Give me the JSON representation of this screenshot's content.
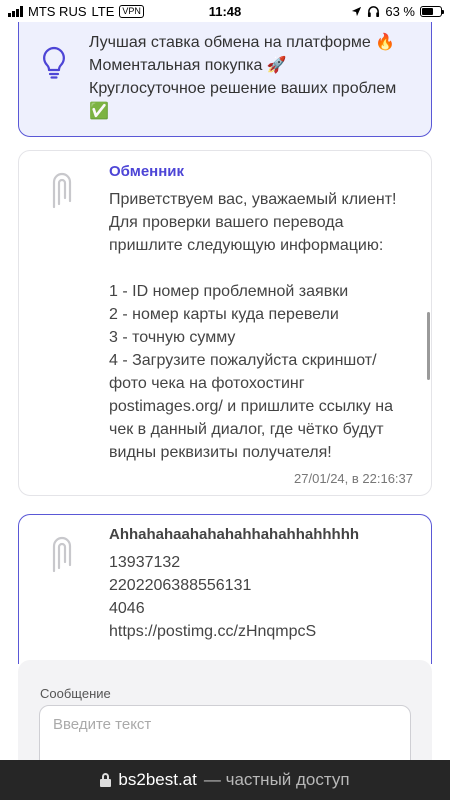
{
  "status_bar": {
    "carrier": "MTS RUS",
    "network": "LTE",
    "vpn": "VPN",
    "time": "11:48",
    "battery": "63 %",
    "battery_level": 0.63,
    "icons": [
      "signal-icon",
      "location-arrow-icon",
      "headphones-icon",
      "battery-icon"
    ]
  },
  "promo": {
    "icon": "lightbulb-icon",
    "lines": [
      "Лучшая ставка обмена на платформе 🔥",
      "Моментальная покупка 🚀",
      "Круглосуточное решение ваших проблем",
      "✅"
    ]
  },
  "operator_message": {
    "avatar_icon": "brand-logo-icon",
    "sender": "Обменник",
    "text": "Приветствуем вас, уважаемый клиент! Для проверки вашего перевода пришлите следующую информацию:\n\n1 - ID номер проблемной заявки\n2 - номер карты куда перевели\n3 - точную сумму\n4 - Загрузите пожалуйста скриншот/ фото чека на фотохостинг postimages.org/ и пришлите ссылку на чек в данный диалог, где чётко будут видны реквизиты получателя!",
    "timestamp": "27/01/24, в 22:16:37"
  },
  "user_reply": {
    "avatar_icon": "brand-logo-icon",
    "sender": "Ahhahahaahahahahhahahhahhhhh",
    "text": "13937132\n2202206388556131\n4046\nhttps://postimg.cc/zHnqmpcS"
  },
  "composer": {
    "label": "Сообщение",
    "placeholder": "Введите текст",
    "value": ""
  },
  "browser_bar": {
    "domain": "bs2best.at",
    "description": "— частный доступ",
    "icon": "lock-icon"
  },
  "colors": {
    "accent": "#5a58d6",
    "accent_text": "#4d45d6",
    "promo_bg": "#eef0fd",
    "url_bar_bg": "#262626"
  }
}
